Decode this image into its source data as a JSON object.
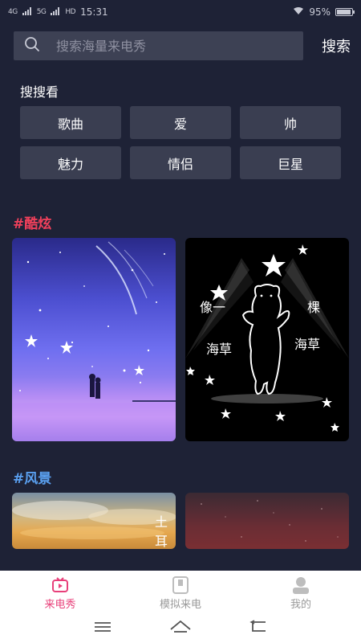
{
  "status": {
    "time": "15:31",
    "signal1": "4G",
    "signal2": "5G",
    "hd": "HD",
    "battery": "95%"
  },
  "search": {
    "placeholder": "搜索海量来电秀",
    "button_label": "搜索"
  },
  "hot_search": {
    "title": "搜搜看",
    "tags": [
      "歌曲",
      "爱",
      "帅",
      "魅力",
      "情侣",
      "巨星"
    ]
  },
  "categories": [
    {
      "title": "#酷炫",
      "color": "#f0405b"
    },
    {
      "title": "#风景",
      "color": "#5aa0f0"
    }
  ],
  "cards": {
    "bear_text": [
      "像一",
      "棵",
      "海草",
      "海草"
    ],
    "sky_text": [
      "土",
      "耳"
    ]
  },
  "bottom_nav": {
    "tabs": [
      {
        "label": "来电秀",
        "icon": "tv-icon"
      },
      {
        "label": "模拟来电",
        "icon": "phone-frame-icon"
      },
      {
        "label": "我的",
        "icon": "person-icon"
      }
    ],
    "active_color": "#e8407a"
  }
}
